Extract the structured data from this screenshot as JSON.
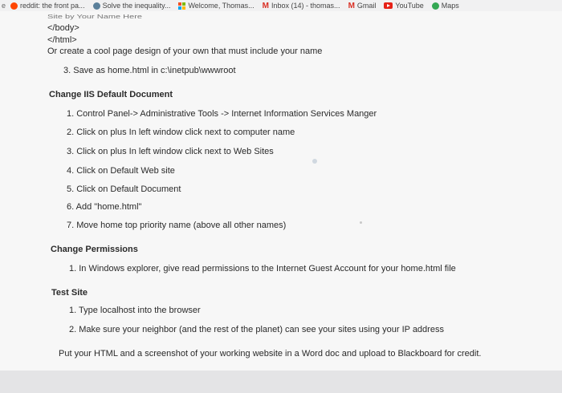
{
  "bookmarks": {
    "lead": "e",
    "items": [
      {
        "icon": "reddit-icon",
        "label": "reddit: the front pa..."
      },
      {
        "icon": "socratic-icon",
        "label": "Solve the inequality..."
      },
      {
        "icon": "microsoft-icon",
        "label": "Welcome, Thomas..."
      },
      {
        "icon": "gmail-icon",
        "label": "Inbox (14) - thomas..."
      },
      {
        "icon": "gmail-icon",
        "label": "Gmail"
      },
      {
        "icon": "youtube-icon",
        "label": "YouTube"
      },
      {
        "icon": "maps-icon",
        "label": "Maps"
      }
    ]
  },
  "doc": {
    "cut_line": "Site by Your Name Here",
    "code_lines": [
      "</body>",
      "</html>"
    ],
    "intro": "Or create a cool page design of your own that must include your name",
    "step3": "3. Save as home.html in c:\\inetpub\\wwwroot",
    "section1": {
      "title": "Change IIS Default Document",
      "items": [
        "1. Control Panel-> Administrative Tools -> Internet Information Services Manger",
        "2. Click on plus In left window click next to computer name",
        "3. Click on plus In left window click next to Web Sites",
        "4. Click on Default Web site",
        "5. Click on Default Document",
        "6. Add \"home.html\"",
        "7. Move home top priority name (above all other names)"
      ]
    },
    "section2": {
      "title": "Change Permissions",
      "items": [
        "1. In Windows explorer, give read permissions to the Internet Guest Account for your home.html file"
      ]
    },
    "section3": {
      "title": "Test Site",
      "items": [
        "1. Type localhost into the browser",
        "2. Make sure your neighbor (and the rest of the planet) can see your sites using your IP address"
      ]
    },
    "footer": "Put your HTML and a screenshot of your working website in a Word doc and upload to Blackboard for credit."
  }
}
